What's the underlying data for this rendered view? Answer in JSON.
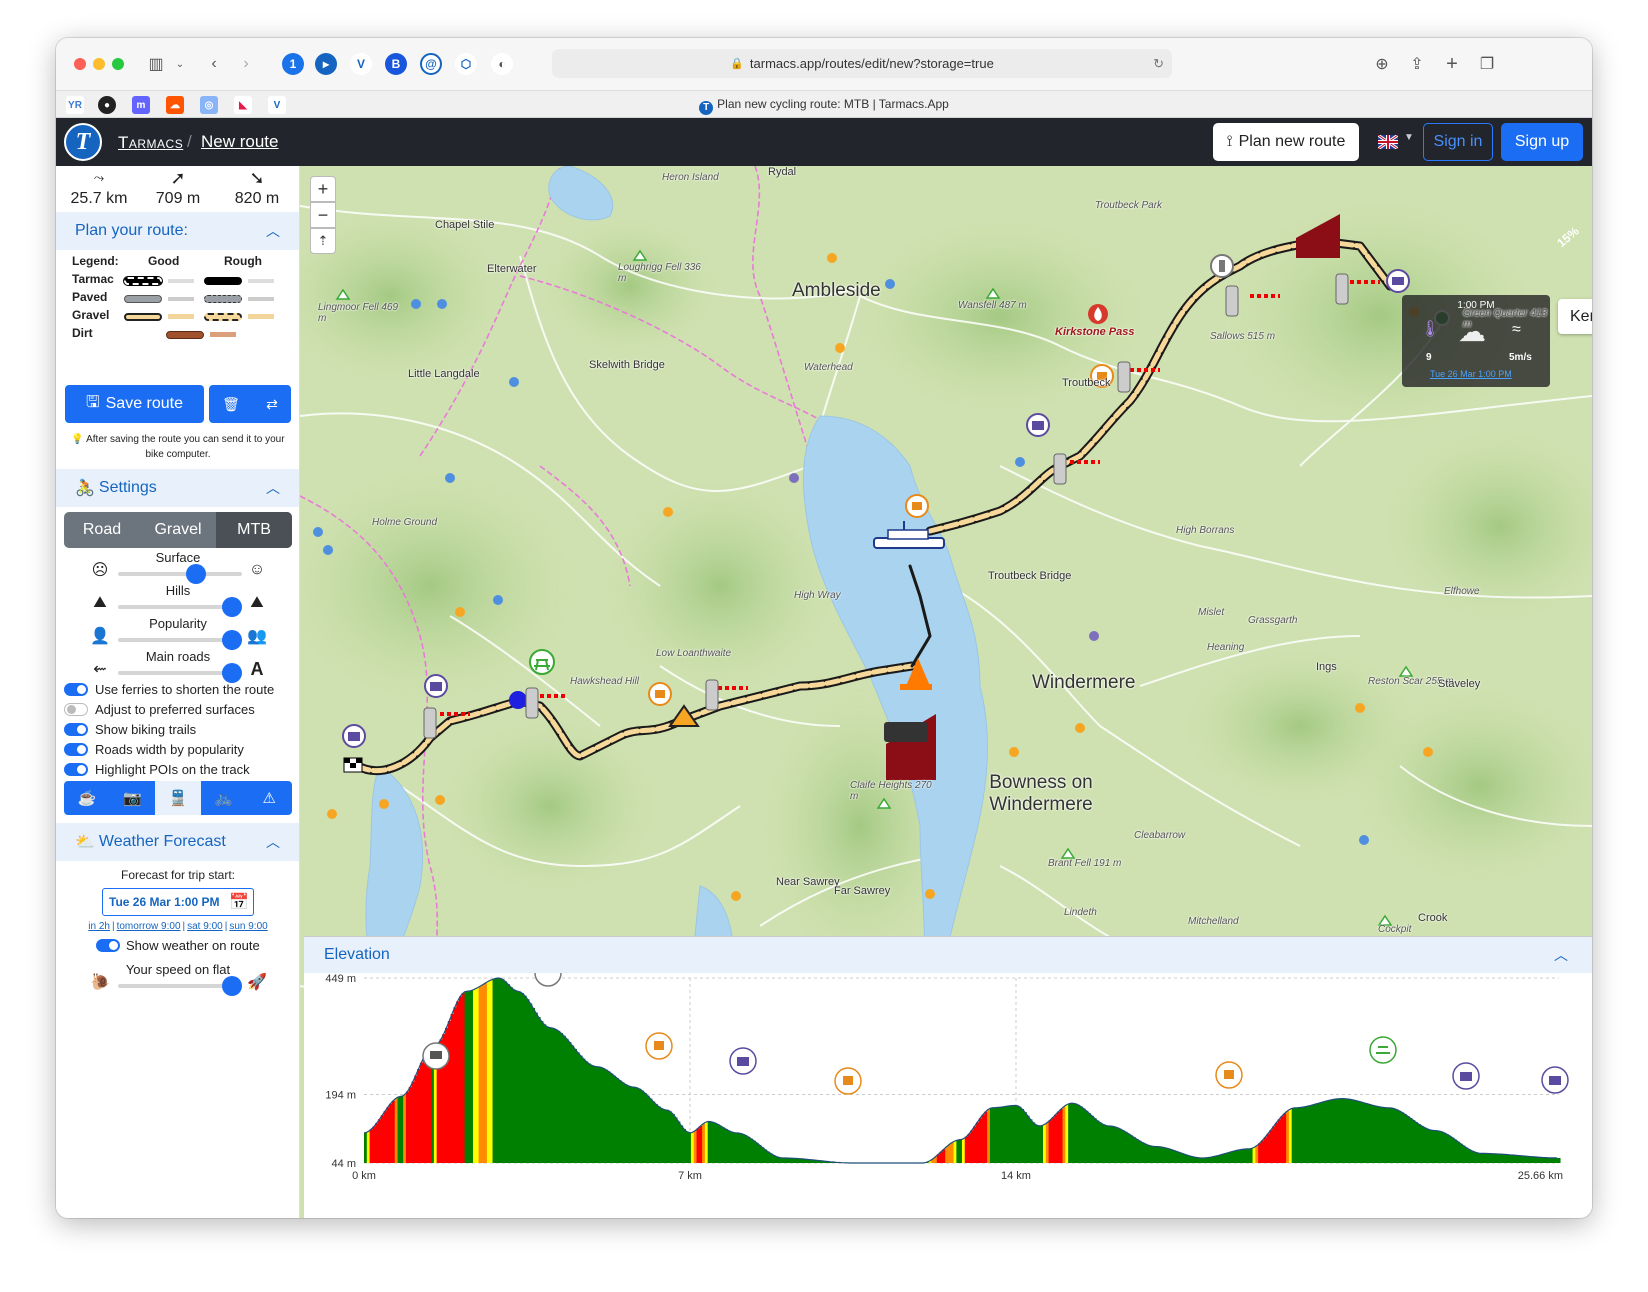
{
  "browser": {
    "url": "tarmacs.app/routes/edit/new?storage=true",
    "tab_title": "Plan new cycling route: MTB | Tarmacs.App"
  },
  "header": {
    "brand": "Tarmacs",
    "breadcrumb": "New route",
    "plan_button": "Plan new route",
    "sign_in": "Sign in",
    "sign_up": "Sign up"
  },
  "stats": {
    "distance": "25.7 km",
    "ascent": "709 m",
    "descent": "820 m"
  },
  "plan": {
    "title": "Plan your route:",
    "legend_label": "Legend:",
    "good": "Good",
    "rough": "Rough",
    "rows": [
      "Tarmac",
      "Paved",
      "Gravel",
      "Dirt"
    ],
    "save_button": "Save route",
    "save_note": "After saving the route you can send it to your bike computer."
  },
  "settings": {
    "title": "Settings",
    "bike_types": [
      "Road",
      "Gravel",
      "MTB"
    ],
    "active_bike": "MTB",
    "sliders": [
      {
        "label": "Surface",
        "value": 0.7
      },
      {
        "label": "Hills",
        "value": 1.0
      },
      {
        "label": "Popularity",
        "value": 1.0
      },
      {
        "label": "Main roads",
        "value": 1.0
      }
    ],
    "toggles": [
      {
        "label": "Use ferries to shorten the route",
        "on": true
      },
      {
        "label": "Adjust to preferred surfaces",
        "on": false
      },
      {
        "label": "Show biking trails",
        "on": true
      },
      {
        "label": "Roads width by popularity",
        "on": true
      },
      {
        "label": "Highlight POIs on the track",
        "on": true
      }
    ],
    "poi_icons": [
      "cafe-icon",
      "camera-icon",
      "train-icon",
      "bicycle-icon",
      "warning-icon"
    ]
  },
  "weather": {
    "title": "Weather Forecast",
    "forecast_label": "Forecast for trip start:",
    "date": "Tue 26 Mar 1:00 PM",
    "quick_links": [
      "in 2h",
      "tomorrow 9:00",
      "sat 9:00",
      "sun 9:00"
    ],
    "show_on_route": "Show weather on route",
    "speed_label": "Your speed on flat",
    "speed_value": 1.0
  },
  "map": {
    "zoom_in": "+",
    "zoom_out": "−",
    "place_search": "Kentmere, Kendal, Englar",
    "weather_widget": {
      "time": "1:00 PM",
      "temp": "9",
      "wind": "5m/s",
      "date_link": "Tue 26 Mar 1:00 PM"
    },
    "gradient_badge": "15%",
    "labels": [
      {
        "text": "Rydal",
        "cls": "v"
      },
      {
        "text": "Heron Island",
        "cls": "i"
      },
      {
        "text": "Chapel Stile",
        "cls": "v"
      },
      {
        "text": "Elterwater",
        "cls": "v"
      },
      {
        "text": "Loughrigg Fell 336 m",
        "cls": "i"
      },
      {
        "text": "Ambleside",
        "cls": "t"
      },
      {
        "text": "Wansfell 487 m",
        "cls": "i"
      },
      {
        "text": "Troutbeck Park",
        "cls": "i"
      },
      {
        "text": "Lingmoor Fell 469 m",
        "cls": "i"
      },
      {
        "text": "Kirkstone Pass",
        "cls": "r"
      },
      {
        "text": "Sallows 515 m",
        "cls": "i"
      },
      {
        "text": "Green Quarter 413 m",
        "cls": "i"
      },
      {
        "text": "Waterhead",
        "cls": "i"
      },
      {
        "text": "Skelwith Bridge",
        "cls": "v"
      },
      {
        "text": "Little Langdale",
        "cls": "v"
      },
      {
        "text": "Troutbeck",
        "cls": "v"
      },
      {
        "text": "Holme Ground",
        "cls": "i"
      },
      {
        "text": "High Borrans",
        "cls": "i"
      },
      {
        "text": "Troutbeck Bridge",
        "cls": "v"
      },
      {
        "text": "High Wray",
        "cls": "i"
      },
      {
        "text": "Elfhowe",
        "cls": "i"
      },
      {
        "text": "Mislet",
        "cls": "i"
      },
      {
        "text": "Grassgarth",
        "cls": "i"
      },
      {
        "text": "Heaning",
        "cls": "i"
      },
      {
        "text": "Ings",
        "cls": "v"
      },
      {
        "text": "Low Loanthwaite",
        "cls": "i"
      },
      {
        "text": "Hawkshead Hill",
        "cls": "i"
      },
      {
        "text": "Windermere",
        "cls": "t"
      },
      {
        "text": "Reston Scar 255 m",
        "cls": "i"
      },
      {
        "text": "Staveley",
        "cls": "v"
      },
      {
        "text": "Claife Heights 270 m",
        "cls": "i"
      },
      {
        "text": "Bowness on Windermere",
        "cls": "t"
      },
      {
        "text": "Cleabarrow",
        "cls": "i"
      },
      {
        "text": "Brant Fell 191 m",
        "cls": "i"
      },
      {
        "text": "Near Sawrey",
        "cls": "v"
      },
      {
        "text": "Far Sawrey",
        "cls": "v"
      },
      {
        "text": "Lindeth",
        "cls": "i"
      },
      {
        "text": "Mitchelland",
        "cls": "i"
      },
      {
        "text": "Crook",
        "cls": "v"
      },
      {
        "text": "Cockpit",
        "cls": "i"
      }
    ]
  },
  "elevation": {
    "title": "Elevation",
    "y_labels": [
      "449 m",
      "194 m",
      "44 m"
    ],
    "x_labels": [
      "0 km",
      "7 km",
      "14 km",
      "25.66 km"
    ],
    "grade_colors": {
      "steep": "#ff0000",
      "hard": "#ff8c00",
      "moderate": "#ffff00",
      "flat": "#008000"
    },
    "chart_data": {
      "type": "area",
      "xlabel": "",
      "ylabel": "",
      "ylim": [
        44,
        449
      ],
      "xlim": [
        0,
        25.66
      ],
      "x": [
        0,
        0.8,
        1.5,
        2.2,
        2.9,
        3.3,
        4.0,
        5.0,
        5.8,
        6.5,
        7.0,
        7.4,
        8.0,
        9.0,
        10.5,
        12.0,
        12.8,
        13.5,
        14.0,
        14.5,
        15.2,
        16.0,
        17.0,
        18.0,
        19.0,
        20.0,
        21.0,
        22.0,
        23.0,
        24.0,
        25.66
      ],
      "y": [
        110,
        190,
        300,
        420,
        449,
        420,
        340,
        255,
        210,
        160,
        110,
        135,
        110,
        55,
        44,
        44,
        95,
        165,
        170,
        125,
        175,
        125,
        80,
        55,
        75,
        165,
        185,
        165,
        115,
        65,
        55
      ]
    }
  }
}
